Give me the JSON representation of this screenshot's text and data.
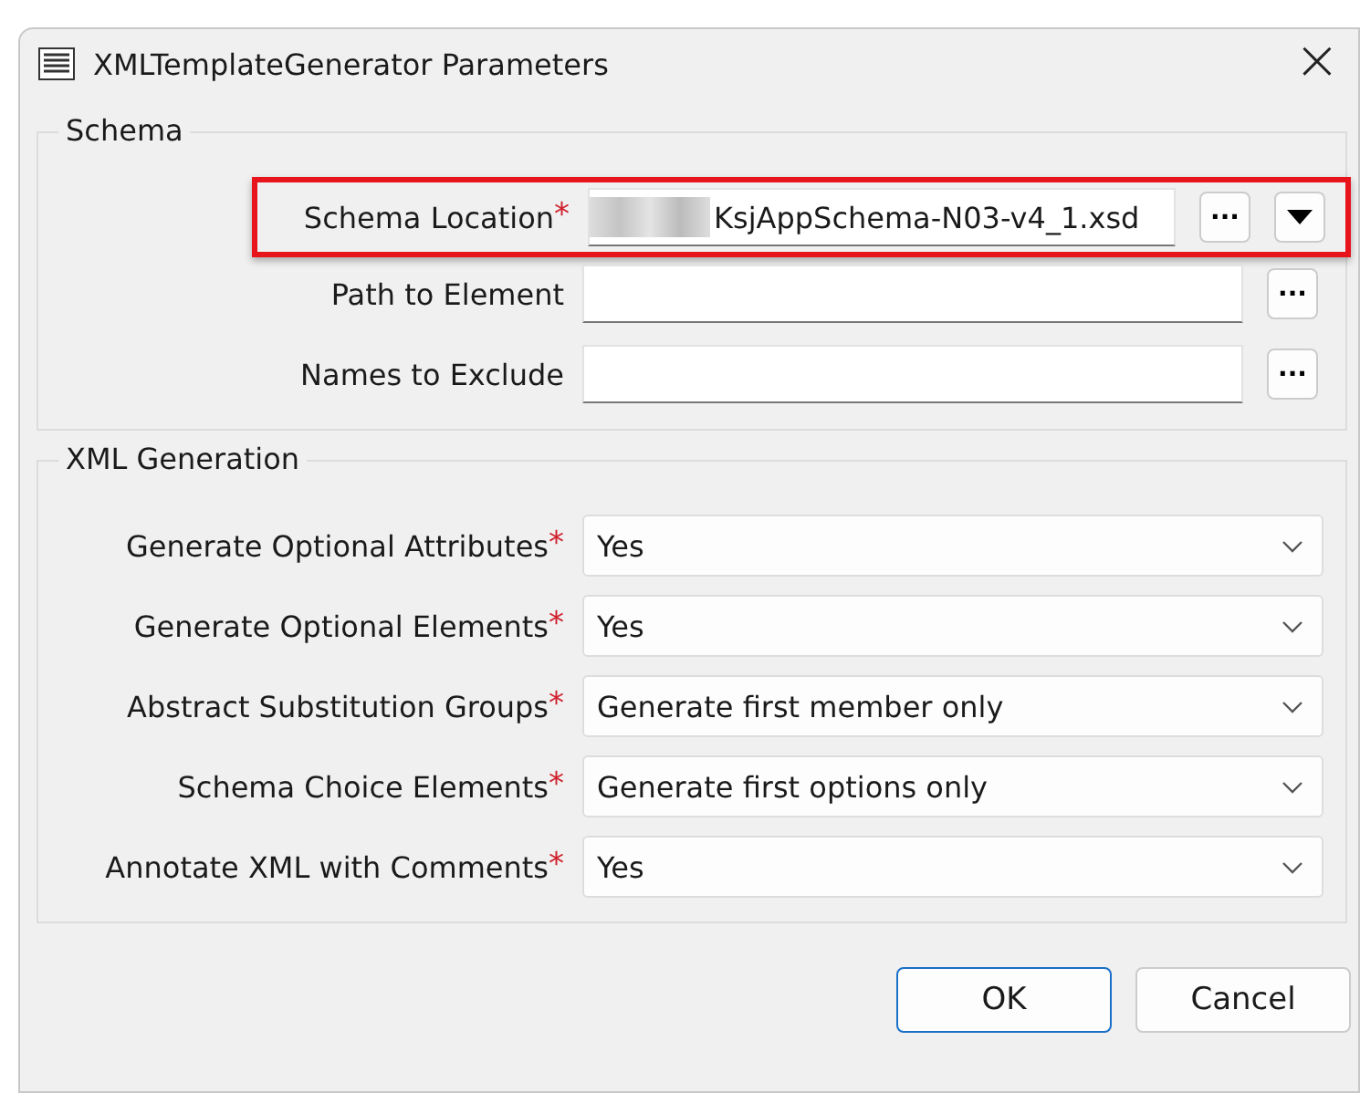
{
  "window": {
    "title": "XMLTemplateGenerator Parameters",
    "close": "×"
  },
  "groups": [
    {
      "title": "Schema",
      "rows": [
        {
          "kind": "file",
          "label": "Schema Location",
          "required_mark": "*",
          "highlighted": true,
          "redacted": true,
          "value": "KsjAppSchema-N03-v4_1.xsd",
          "browse": "...",
          "menu": true
        },
        {
          "kind": "file",
          "label": "Path to Element",
          "highlighted": false,
          "redacted": false,
          "browse": "...",
          "menu": false
        },
        {
          "kind": "file",
          "label": "Names to Exclude",
          "highlighted": false,
          "redacted": false,
          "browse": "...",
          "menu": false
        }
      ]
    },
    {
      "title": "XML Generation",
      "rows": [
        {
          "kind": "choice",
          "label": "Generate Optional Attributes",
          "required_mark": "*",
          "value": "Yes"
        },
        {
          "kind": "choice",
          "label": "Generate Optional Elements",
          "required_mark": "*",
          "value": "Yes"
        },
        {
          "kind": "choice",
          "label": "Abstract Substitution Groups",
          "required_mark": "*",
          "value": "Generate first member only"
        },
        {
          "kind": "choice",
          "label": "Schema Choice Elements",
          "required_mark": "*",
          "value": "Generate first options only"
        },
        {
          "kind": "choice",
          "label": "Annotate XML with Comments",
          "required_mark": "*",
          "value": "Yes"
        }
      ]
    }
  ],
  "buttons": [
    {
      "label": "OK",
      "default": true
    },
    {
      "label": "Cancel",
      "default": false
    }
  ]
}
